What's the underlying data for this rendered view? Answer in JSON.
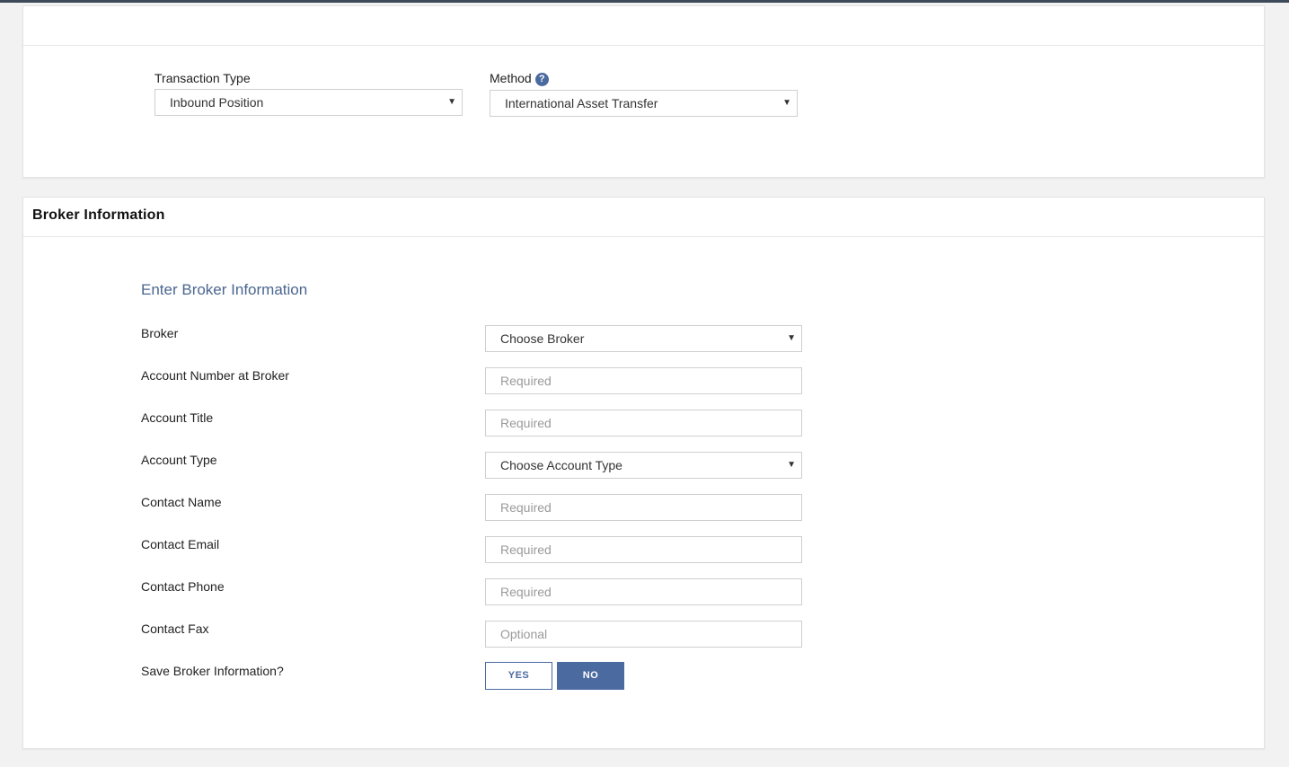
{
  "transaction": {
    "type_label": "Transaction Type",
    "type_value": "Inbound Position",
    "method_label": "Method",
    "method_help": "?",
    "method_value": "International Asset Transfer"
  },
  "broker_section": {
    "title": "Broker Information",
    "subheading": "Enter Broker Information",
    "fields": {
      "broker": {
        "label": "Broker",
        "value": "Choose Broker"
      },
      "account_number": {
        "label": "Account Number at Broker",
        "placeholder": "Required"
      },
      "account_title": {
        "label": "Account Title",
        "placeholder": "Required"
      },
      "account_type": {
        "label": "Account Type",
        "value": "Choose Account Type"
      },
      "contact_name": {
        "label": "Contact Name",
        "placeholder": "Required"
      },
      "contact_email": {
        "label": "Contact Email",
        "placeholder": "Required"
      },
      "contact_phone": {
        "label": "Contact Phone",
        "placeholder": "Required"
      },
      "contact_fax": {
        "label": "Contact Fax",
        "placeholder": "Optional"
      }
    },
    "save": {
      "label": "Save Broker Information?",
      "yes": "YES",
      "no": "NO",
      "selected": "NO"
    }
  },
  "icons": {
    "dropdown": "caret-down-icon",
    "help": "question-circle-icon"
  },
  "colors": {
    "accent": "#4a6aa0",
    "subheading": "#4a6690",
    "background": "#f2f2f2"
  }
}
